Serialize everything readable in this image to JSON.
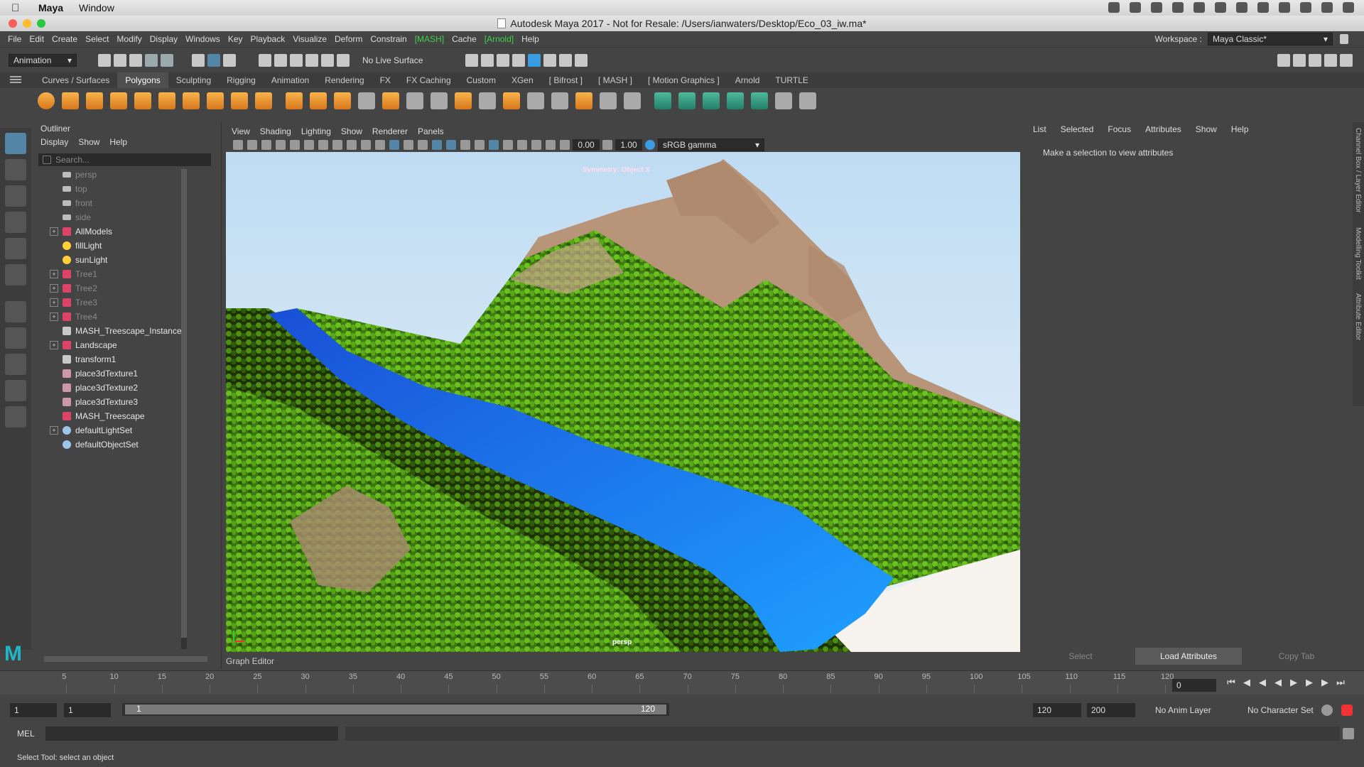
{
  "mac_menu": {
    "app": "Maya",
    "items": [
      "Window"
    ]
  },
  "window": {
    "title": "Autodesk Maya 2017 - Not for Resale: /Users/ianwaters/Desktop/Eco_03_iw.ma*"
  },
  "main_menu": {
    "items": [
      "File",
      "Edit",
      "Create",
      "Select",
      "Modify",
      "Display",
      "Windows",
      "Key",
      "Playback",
      "Visualize",
      "Deform",
      "Constrain",
      "[MASH]",
      "Cache",
      "[Arnold]",
      "Help"
    ],
    "workspace_label": "Workspace :",
    "workspace_value": "Maya Classic*"
  },
  "status_line": {
    "menu_set": "Animation",
    "live_surface": "No Live Surface"
  },
  "shelf": {
    "tabs": [
      "Curves / Surfaces",
      "Polygons",
      "Sculpting",
      "Rigging",
      "Animation",
      "Rendering",
      "FX",
      "FX Caching",
      "Custom",
      "XGen",
      "[ Bifrost ]",
      "[ MASH ]",
      "[ Motion Graphics ]",
      "Arnold",
      "TURTLE"
    ],
    "active_tab": "Polygons"
  },
  "outliner": {
    "title": "Outliner",
    "menu": [
      "Display",
      "Show",
      "Help"
    ],
    "search_placeholder": "Search...",
    "items": [
      {
        "label": "persp",
        "icon": "camera-icon",
        "dim": true,
        "expandable": false
      },
      {
        "label": "top",
        "icon": "camera-icon",
        "dim": true,
        "expandable": false
      },
      {
        "label": "front",
        "icon": "camera-icon",
        "dim": true,
        "expandable": false
      },
      {
        "label": "side",
        "icon": "camera-icon",
        "dim": true,
        "expandable": false
      },
      {
        "label": "AllModels",
        "icon": "mesh-icon",
        "dim": false,
        "expandable": true
      },
      {
        "label": "fillLight",
        "icon": "light-icon",
        "dim": false,
        "expandable": false
      },
      {
        "label": "sunLight",
        "icon": "directional-light-icon",
        "dim": false,
        "expandable": false
      },
      {
        "label": "Tree1",
        "icon": "mesh-icon",
        "dim": true,
        "expandable": true
      },
      {
        "label": "Tree2",
        "icon": "mesh-icon",
        "dim": true,
        "expandable": true
      },
      {
        "label": "Tree3",
        "icon": "mesh-icon",
        "dim": true,
        "expandable": true
      },
      {
        "label": "Tree4",
        "icon": "mesh-icon",
        "dim": true,
        "expandable": true
      },
      {
        "label": "MASH_Treescape_Instancer",
        "icon": "instancer-icon",
        "dim": false,
        "expandable": false
      },
      {
        "label": "Landscape",
        "icon": "mesh-icon",
        "dim": false,
        "expandable": true
      },
      {
        "label": "transform1",
        "icon": "transform-icon",
        "dim": false,
        "expandable": false
      },
      {
        "label": "place3dTexture1",
        "icon": "texture-icon",
        "dim": false,
        "expandable": false
      },
      {
        "label": "place3dTexture2",
        "icon": "texture-icon",
        "dim": false,
        "expandable": false
      },
      {
        "label": "place3dTexture3",
        "icon": "texture-icon",
        "dim": false,
        "expandable": false
      },
      {
        "label": "MASH_Treescape",
        "icon": "mash-icon",
        "dim": false,
        "expandable": false
      },
      {
        "label": "defaultLightSet",
        "icon": "set-icon",
        "dim": false,
        "expandable": true
      },
      {
        "label": "defaultObjectSet",
        "icon": "set-icon",
        "dim": false,
        "expandable": false
      }
    ]
  },
  "viewport": {
    "menu": [
      "View",
      "Shading",
      "Lighting",
      "Show",
      "Renderer",
      "Panels"
    ],
    "exposure": "0.00",
    "gamma": "1.00",
    "color_space": "sRGB gamma",
    "symmetry_label": "Symmetry: Object X",
    "camera_label": "persp"
  },
  "graph_editor_label": "Graph Editor",
  "attribute_editor": {
    "tabs": [
      "List",
      "Selected",
      "Focus",
      "Attributes",
      "Show",
      "Help"
    ],
    "message": "Make a selection to view attributes",
    "buttons": [
      "Select",
      "Load Attributes",
      "Copy Tab"
    ]
  },
  "side_tabs": [
    "Channel Box / Layer Editor",
    "Modelling Toolkit",
    "Attribute Editor"
  ],
  "timeline": {
    "ticks": [
      5,
      10,
      15,
      20,
      25,
      30,
      35,
      40,
      45,
      50,
      55,
      60,
      65,
      70,
      75,
      80,
      85,
      90,
      95,
      100,
      105,
      110,
      115,
      120
    ],
    "range_max": 120,
    "current_frame": "0"
  },
  "range_slider": {
    "start": "1",
    "playback_start": "1",
    "bar_start": "1",
    "bar_end": "120",
    "playback_end": "120",
    "end": "200",
    "anim_layer": "No Anim Layer",
    "character_set": "No Character Set"
  },
  "command_line": {
    "label": "MEL"
  },
  "help_line": "Select Tool: select an object"
}
